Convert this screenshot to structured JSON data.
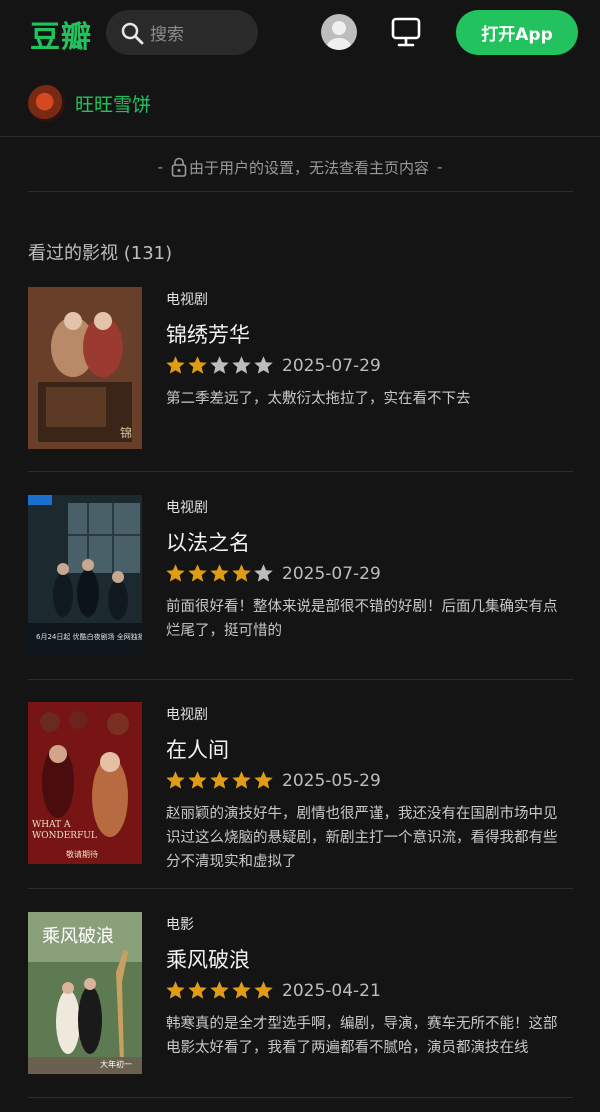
{
  "header": {
    "logo": "豆瓣",
    "search_placeholder": "搜索",
    "open_app_label": "打开App"
  },
  "user": {
    "name": "旺旺雪饼"
  },
  "privacy_notice": {
    "dash_left": "-",
    "text": "由于用户的设置，无法查看主页内容",
    "dash_right": "-"
  },
  "section": {
    "title": "看过的影视 (131)"
  },
  "colors": {
    "brand_green": "#22c35e",
    "star_filled": "#e09c15",
    "star_empty": "#bdbdbd",
    "background": "#141414"
  },
  "items": [
    {
      "type": "电视剧",
      "title": "锦绣芳华",
      "rating": 2,
      "date": "2025-07-29",
      "comment": "第二季差远了，太敷衍太拖拉了，实在看不下去",
      "poster_text": ""
    },
    {
      "type": "电视剧",
      "title": "以法之名",
      "rating": 4,
      "date": "2025-07-29",
      "comment": "前面很好看！整体来说是部很不错的好剧！后面几集确实有点烂尾了，挺可惜的",
      "poster_text": "6月24日起 优酷白夜剧场 全网独播"
    },
    {
      "type": "电视剧",
      "title": "在人间",
      "rating": 5,
      "date": "2025-05-29",
      "comment": "赵丽颖的演技好牛，剧情也很严谨，我还没有在国剧市场中见识过这么烧脑的悬疑剧，新剧主打一个意识流，看得我都有些分不清现实和虚拟了",
      "poster_text": "敬请期待"
    },
    {
      "type": "电影",
      "title": "乘风破浪",
      "rating": 5,
      "date": "2025-04-21",
      "comment": "韩寒真的是全才型选手啊，编剧，导演，赛车无所不能！这部电影太好看了，我看了两遍都看不腻哈，演员都演技在线",
      "poster_text": "大年初一"
    }
  ]
}
